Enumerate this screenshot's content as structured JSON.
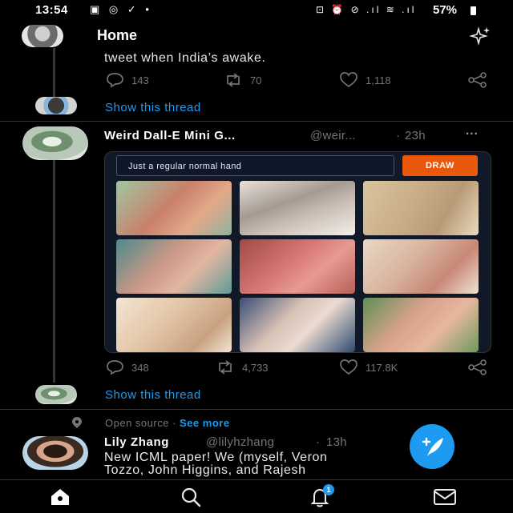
{
  "status_bar": {
    "time": "13:54",
    "left_icons": "▣ ◎ ✓ •",
    "right_icons": "⊡ ⏰ ⊘ .ıl ≋ .ıl",
    "battery": "57%"
  },
  "header": {
    "title": "Home"
  },
  "top_tweet": {
    "text": "tweet when India’s awake.",
    "replies": "143",
    "retweets": "70",
    "likes": "1,118",
    "show_thread": "Show this thread"
  },
  "tweet2": {
    "name": "Weird Dall-E Mini G...",
    "handle": "@weir...",
    "dot": "·",
    "time": "23h",
    "more": "···",
    "card": {
      "input_value": "Just a regular normal hand",
      "draw_label": "DRAW"
    },
    "replies": "348",
    "retweets": "4,733",
    "likes": "117.8K",
    "show_thread": "Show this thread"
  },
  "topic": {
    "label": "Open source",
    "separator": "·",
    "see_more": "See more"
  },
  "tweet3": {
    "name": "Lily Zhang",
    "handle": "@lilyhzhang",
    "dot": "·",
    "time": "13h",
    "line1": "New ICML paper! We (myself, Veron",
    "line2": "Tozzo, John Higgins, and Rajesh"
  },
  "bottom_nav": {
    "notification_count": "1"
  },
  "colors": {
    "accent": "#1d9bf0",
    "draw_button": "#ea580c",
    "background": "#000000"
  }
}
